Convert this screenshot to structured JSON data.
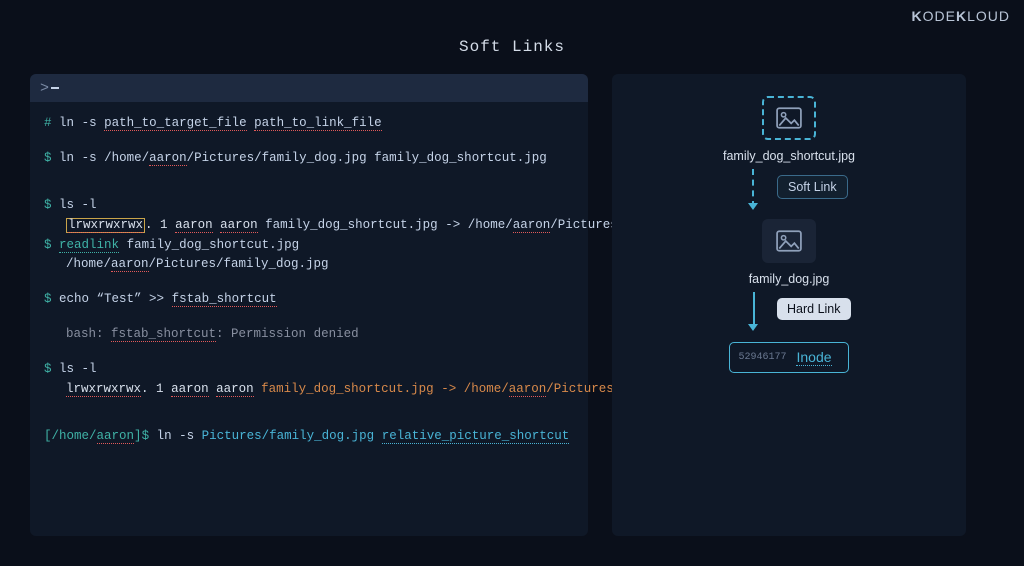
{
  "brand": {
    "k1": "K",
    "ode": "ODE",
    "k2": "K",
    "loud": "LOUD"
  },
  "title": "Soft Links",
  "prompt_symbol": ">",
  "terminal": {
    "l1": {
      "hash": "#",
      "cmd": "ln",
      "flag": "-s",
      "arg1": "path_to_target_file",
      "arg2": "path_to_link_file"
    },
    "l2": {
      "p": "$",
      "cmd": "ln",
      "flag": "-s",
      "path1a": "/home/",
      "path1b": "aaron",
      "path1c": "/Pictures/family_dog.jpg",
      "arg2": "family_dog_shortcut.jpg"
    },
    "l3": {
      "p": "$",
      "cmd": "ls -l"
    },
    "l4": {
      "perm": "lrwxrwxrwx",
      "dot": ".",
      "one": "1",
      "owner": "aaron",
      "group": "aaron",
      "name": "family_dog_shortcut.jpg",
      "arrow": "->",
      "t1": "/home/",
      "t2": "aaron",
      "t3": "/Pictures.."
    },
    "l5": {
      "p": "$",
      "cmd": "readlink",
      "arg": "family_dog_shortcut.jpg"
    },
    "l6": {
      "p1": "/home/",
      "p2": "aaron",
      "p3": "/Pictures/family_dog.jpg"
    },
    "l7": {
      "p": "$",
      "pre": "echo “Test” >> ",
      "arg": "fstab_shortcut"
    },
    "l8": {
      "pre": "bash: ",
      "mid": "fstab_shortcut",
      "post": ": Permission denied"
    },
    "l9": {
      "p": "$",
      "cmd": "ls -l"
    },
    "l10": {
      "perm": "lrwxrwxrwx",
      "dot": ".",
      "one": "1",
      "owner": "aaron",
      "group": "aaron",
      "name": "family_dog_shortcut.jpg",
      "arrow": "->",
      "t1": "/home/",
      "t2": "aaron",
      "t3": "/Pictures.."
    },
    "l11": {
      "br1": "[",
      "p1": "/home/",
      "p2": "aaron",
      "br2": "]",
      "p": "$",
      "cmd": " ln ",
      "flag": "-s",
      "arg1": "Pictures/family_dog.jpg",
      "arg2": "relative_picture_shortcut"
    }
  },
  "diagram": {
    "shortcut_label": "family_dog_shortcut.jpg",
    "softlink_badge": "Soft Link",
    "file_label": "family_dog.jpg",
    "hardlink_badge": "Hard Link",
    "inode_number": "52946177",
    "inode_label": "Inode"
  }
}
